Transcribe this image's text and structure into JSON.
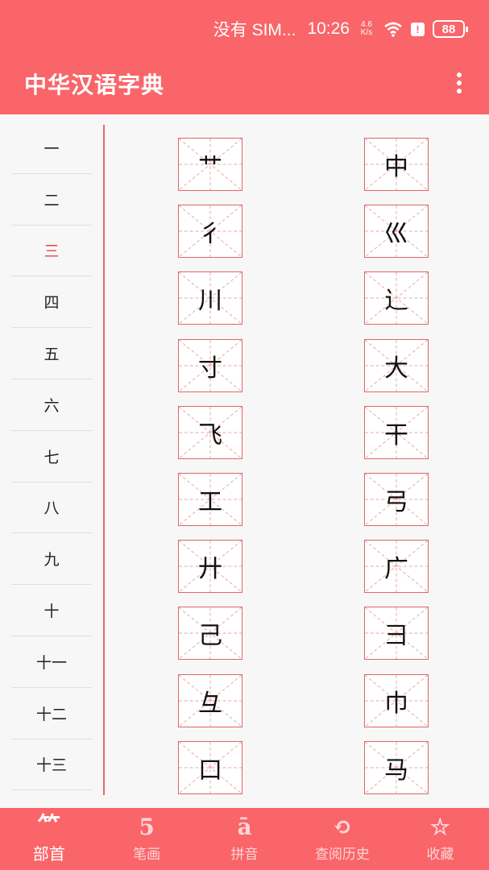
{
  "status_bar": {
    "carrier": "没有 SIM...",
    "time": "10:26",
    "net_speed": "4.6\nK/s",
    "battery": "88"
  },
  "app_bar": {
    "title": "中华汉语字典"
  },
  "sidebar": {
    "items": [
      "一",
      "二",
      "三",
      "四",
      "五",
      "六",
      "七",
      "八",
      "九",
      "十",
      "十一",
      "十二",
      "十三"
    ],
    "active_index": 2
  },
  "radicals": {
    "left": [
      "艹",
      "彳",
      "川",
      "寸",
      "飞",
      "工",
      "廾",
      "己",
      "彑",
      "口"
    ],
    "right": [
      "中",
      "巛",
      "辶",
      "大",
      "干",
      "弓",
      "广",
      "彐",
      "巾",
      "马"
    ]
  },
  "bottom_nav": {
    "items": [
      {
        "label": "部首",
        "icon": "radical-icon"
      },
      {
        "label": "笔画",
        "icon": "stroke-count-icon"
      },
      {
        "label": "拼音",
        "icon": "pinyin-icon"
      },
      {
        "label": "查阅历史",
        "icon": "history-icon"
      },
      {
        "label": "收藏",
        "icon": "favorite-icon"
      }
    ],
    "active_index": 0
  },
  "colors": {
    "accent": "#f96569",
    "grid_line": "#e06468",
    "active_text": "#e2474b"
  }
}
